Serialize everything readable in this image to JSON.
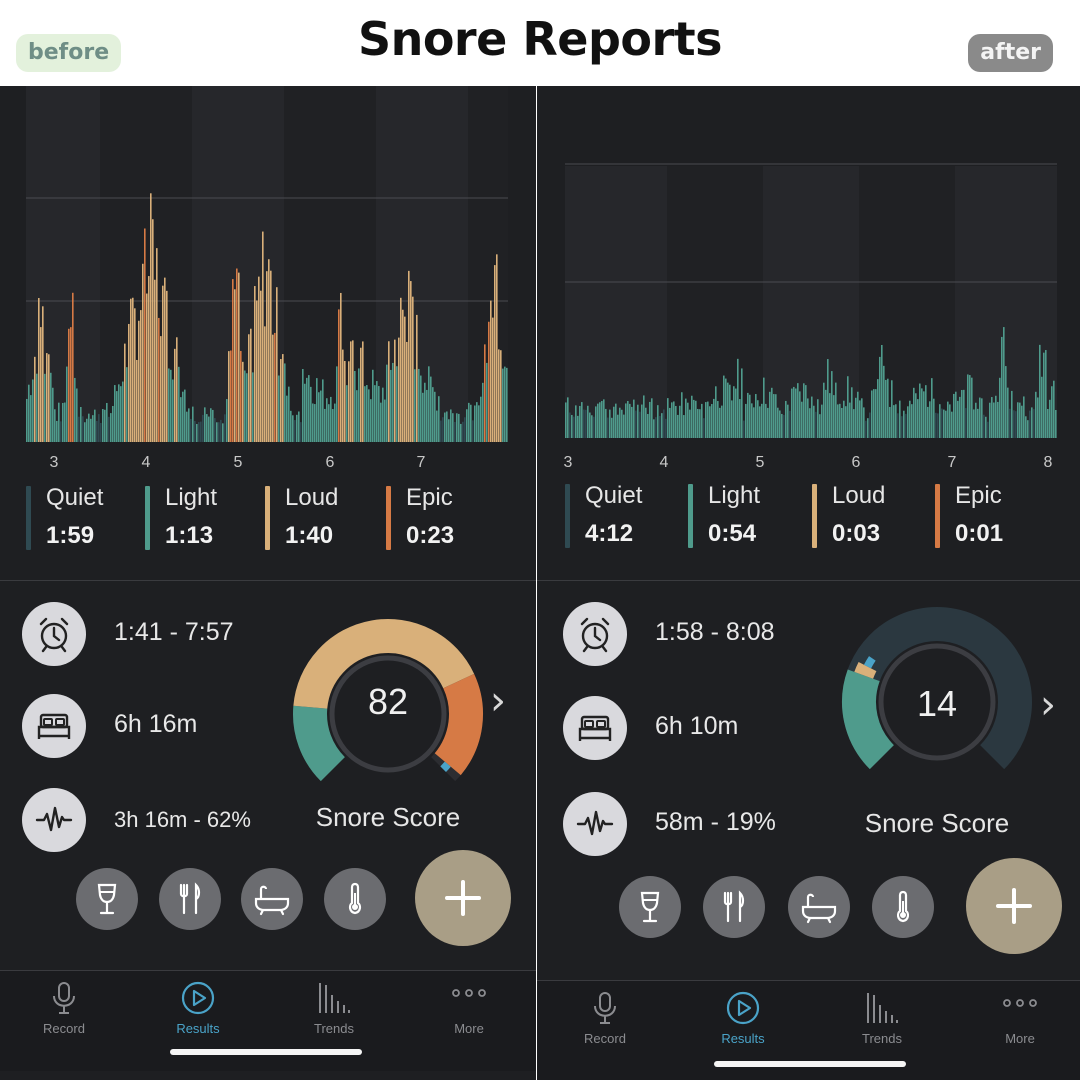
{
  "title": "Snore Reports",
  "before_label": "before",
  "after_label": "after",
  "colors": {
    "quiet": "#2f4a52",
    "light": "#4f9b8c",
    "loud": "#d9b07a",
    "epic": "#d67a45",
    "accent_blue": "#4aa3c8"
  },
  "before": {
    "x_ticks": [
      "3",
      "4",
      "5",
      "6",
      "7"
    ],
    "legend": [
      {
        "label": "Quiet",
        "value": "1:59",
        "color": "#2f4a52"
      },
      {
        "label": "Light",
        "value": "1:13",
        "color": "#4f9b8c"
      },
      {
        "label": "Loud",
        "value": "1:40",
        "color": "#d9b07a"
      },
      {
        "label": "Epic",
        "value": "0:23",
        "color": "#d67a45"
      }
    ],
    "time_range": "1:41 - 7:57",
    "duration": "6h 16m",
    "snore_time": "3h 16m - 62%",
    "score": "82",
    "score_label": "Snore Score"
  },
  "after": {
    "x_ticks": [
      "3",
      "4",
      "5",
      "6",
      "7",
      "8"
    ],
    "legend": [
      {
        "label": "Quiet",
        "value": "4:12",
        "color": "#2f4a52"
      },
      {
        "label": "Light",
        "value": "0:54",
        "color": "#4f9b8c"
      },
      {
        "label": "Loud",
        "value": "0:03",
        "color": "#d9b07a"
      },
      {
        "label": "Epic",
        "value": "0:01",
        "color": "#d67a45"
      }
    ],
    "time_range": "1:58 - 8:08",
    "duration": "6h 10m",
    "snore_time": "58m - 19%",
    "score": "14",
    "score_label": "Snore Score"
  },
  "tabs": [
    {
      "label": "Record",
      "icon": "microphone-icon"
    },
    {
      "label": "Results",
      "icon": "play-circle-icon"
    },
    {
      "label": "Trends",
      "icon": "bar-chart-icon"
    },
    {
      "label": "More",
      "icon": "more-dots-icon"
    }
  ],
  "icons": [
    "alarm-clock-icon",
    "bed-icon",
    "waveform-icon",
    "wine-glass-icon",
    "fork-knife-icon",
    "bathtub-icon",
    "thermometer-icon",
    "plus-icon",
    "chevron-right-icon"
  ]
}
